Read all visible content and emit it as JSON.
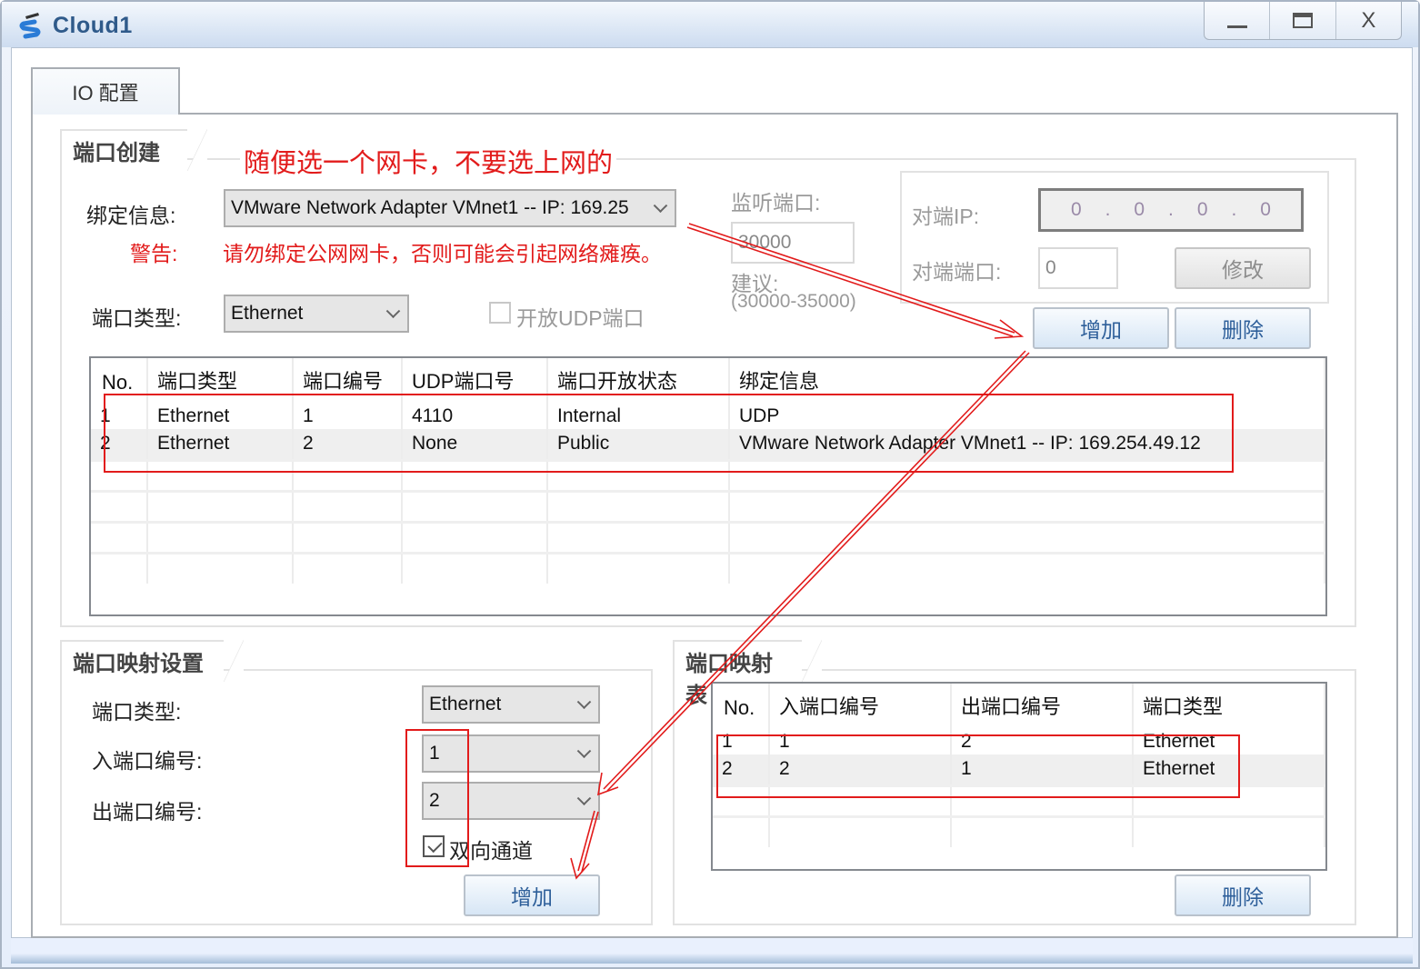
{
  "window": {
    "title": "Cloud1",
    "app_icon": "cloud-device-icon",
    "controls": {
      "minimize": "minimize",
      "maximize": "maximize",
      "close": "X"
    }
  },
  "tabs": [
    {
      "label": "IO 配置",
      "active": true
    }
  ],
  "port_creation": {
    "title": "端口创建",
    "annotation_note": "随便选一个网卡，不要选上网的",
    "binding_label": "绑定信息:",
    "binding_value": "VMware Network Adapter VMnet1 -- IP: 169.25",
    "warning_label": "警告:",
    "warning_text": "请勿绑定公网网卡，否则可能会引起网络瘫痪。",
    "port_type_label": "端口类型:",
    "port_type_value": "Ethernet",
    "open_udp_label": "开放UDP端口",
    "open_udp_checked": false,
    "listen_port_label": "监听端口:",
    "listen_port_value": "30000",
    "suggest_label": "建议:",
    "suggest_range": "(30000-35000)",
    "peer_ip_label": "对端IP:",
    "peer_ip_octets": [
      "0",
      "0",
      "0",
      "0"
    ],
    "peer_port_label": "对端端口:",
    "peer_port_value": "0",
    "modify_button": "修改",
    "add_button": "增加",
    "delete_button": "删除",
    "table": {
      "columns": [
        "No.",
        "端口类型",
        "端口编号",
        "UDP端口号",
        "端口开放状态",
        "绑定信息"
      ],
      "rows": [
        [
          "1",
          "Ethernet",
          "1",
          "4110",
          "Internal",
          "UDP"
        ],
        [
          "2",
          "Ethernet",
          "2",
          "None",
          "Public",
          "VMware Network Adapter VMnet1 -- IP: 169.254.49.12"
        ]
      ]
    }
  },
  "port_mapping_settings": {
    "title": "端口映射设置",
    "port_type_label": "端口类型:",
    "port_type_value": "Ethernet",
    "in_port_label": "入端口编号:",
    "in_port_value": "1",
    "out_port_label": "出端口编号:",
    "out_port_value": "2",
    "bidirectional_label": "双向通道",
    "bidirectional_checked": true,
    "add_button": "增加"
  },
  "port_mapping_table": {
    "title": "端口映射表",
    "columns": [
      "No.",
      "入端口编号",
      "出端口编号",
      "端口类型"
    ],
    "rows": [
      [
        "1",
        "1",
        "2",
        "Ethernet"
      ],
      [
        "2",
        "2",
        "1",
        "Ethernet"
      ]
    ],
    "delete_button": "删除"
  },
  "colors": {
    "annotation_red": "#e21b1b",
    "button_text_blue": "#2e5f9a",
    "title_blue": "#2f5a8a"
  }
}
